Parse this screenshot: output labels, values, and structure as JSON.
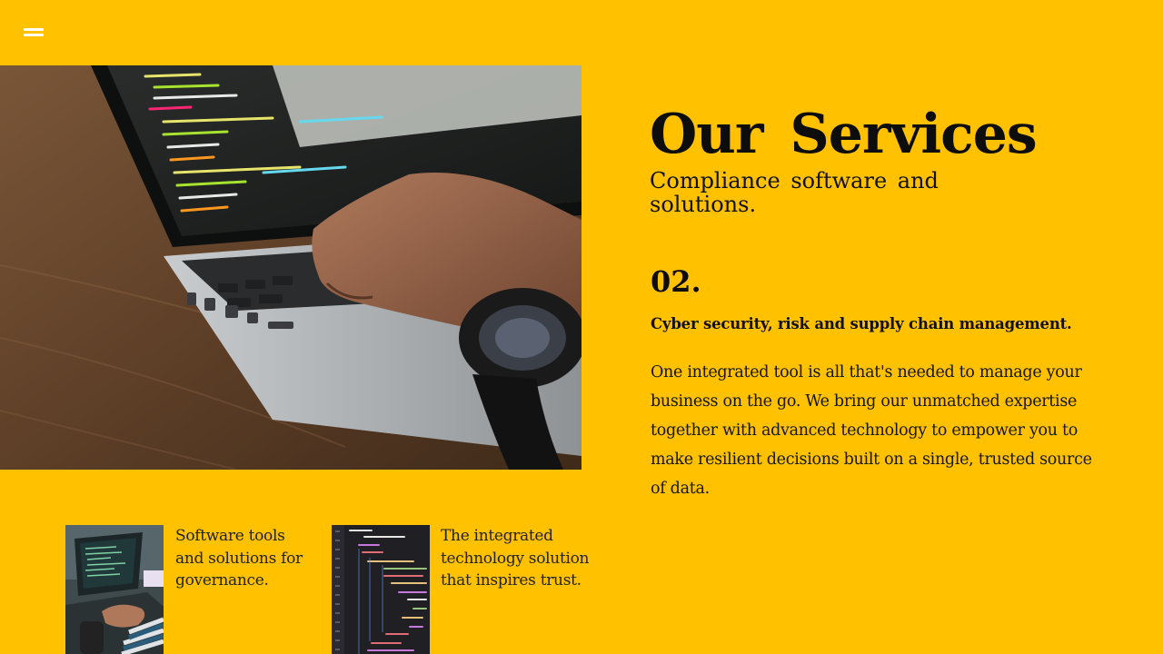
{
  "header": {
    "menu_icon": "hamburger-menu-icon"
  },
  "hero": {
    "image_subject": "hand-typing-on-laptop-with-code-photo"
  },
  "services": {
    "title": "Our Services",
    "subtitle": "Compliance software and solutions.",
    "number": "02.",
    "heading": "Cyber security, risk and supply chain management.",
    "body": "One integrated tool is all that's needed to manage your business on the go. We bring our unmatched expertise together with advanced technology to empower you to make resilient decisions built on a single, trusted source of data."
  },
  "cards": [
    {
      "image_subject": "person-at-laptop-photo",
      "text": "Software tools and solutions for governance."
    },
    {
      "image_subject": "code-on-screen-photo",
      "text": "The integrated technology solution that inspires trust."
    }
  ],
  "colors": {
    "background": "#FFC100",
    "text": "#111111",
    "menu_icon": "#FFFFFF"
  }
}
